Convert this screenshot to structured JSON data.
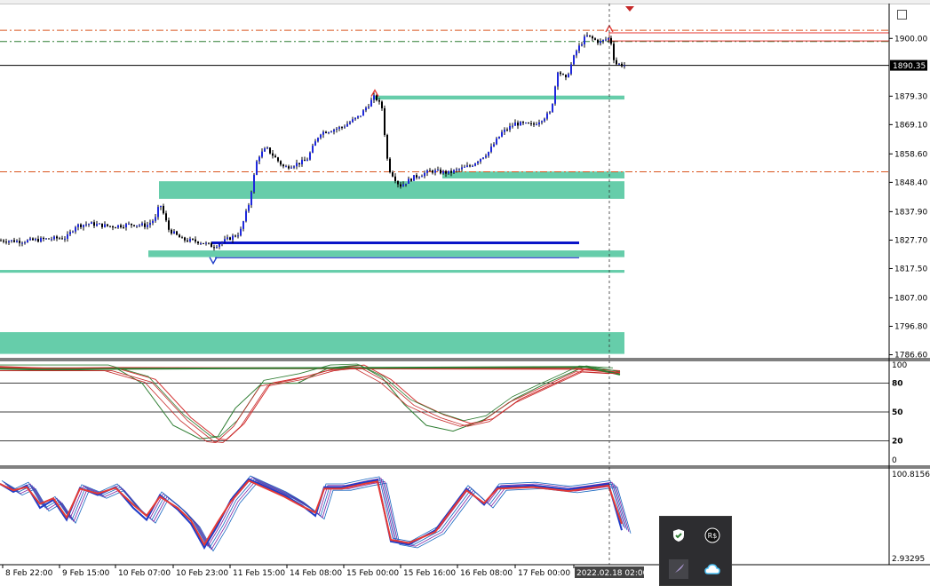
{
  "chart_data": [
    {
      "type": "candlestick",
      "panel": "price",
      "title": "",
      "price_labels": [
        "1900.00",
        "1879.30",
        "1869.10",
        "1858.60",
        "1848.40",
        "1837.90",
        "1827.70",
        "1817.50",
        "1807.00",
        "1796.80",
        "1786.60"
      ],
      "price_label_values": [
        1900.0,
        1879.3,
        1869.1,
        1858.6,
        1848.4,
        1837.9,
        1827.7,
        1817.5,
        1807.0,
        1796.8,
        1786.6
      ],
      "ylim": [
        1785.5,
        1912.5
      ],
      "current_price": "1890.35",
      "current_price_value": 1890.35,
      "trend_waypoints": [
        [
          0,
          1827.6
        ],
        [
          25,
          1827.3
        ],
        [
          50,
          1828.0
        ],
        [
          75,
          1828.6
        ],
        [
          85,
          1832.8
        ],
        [
          100,
          1833.6
        ],
        [
          125,
          1832.6
        ],
        [
          150,
          1833.4
        ],
        [
          165,
          1832.9
        ],
        [
          175,
          1835.5
        ],
        [
          180,
          1841.0
        ],
        [
          190,
          1831.5
        ],
        [
          205,
          1827.9
        ],
        [
          225,
          1827.1
        ],
        [
          240,
          1825.4
        ],
        [
          255,
          1827.8
        ],
        [
          270,
          1830.2
        ],
        [
          280,
          1840.5
        ],
        [
          290,
          1857.5
        ],
        [
          300,
          1860.6
        ],
        [
          320,
          1853.7
        ],
        [
          345,
          1856.2
        ],
        [
          360,
          1866.1
        ],
        [
          385,
          1868.2
        ],
        [
          405,
          1872.2
        ],
        [
          422,
          1879.3
        ],
        [
          430,
          1875.1
        ],
        [
          437,
          1853.7
        ],
        [
          450,
          1847.1
        ],
        [
          465,
          1850.1
        ],
        [
          485,
          1852.5
        ],
        [
          505,
          1851.8
        ],
        [
          530,
          1854.4
        ],
        [
          550,
          1859.3
        ],
        [
          565,
          1866.2
        ],
        [
          580,
          1869.5
        ],
        [
          600,
          1868.9
        ],
        [
          620,
          1873.4
        ],
        [
          628,
          1888.6
        ],
        [
          637,
          1885.3
        ],
        [
          648,
          1895.0
        ],
        [
          660,
          1901.0
        ],
        [
          675,
          1898.6
        ],
        [
          687,
          1900.3
        ],
        [
          692,
          1891.0
        ],
        [
          705,
          1890.3
        ]
      ],
      "levels": [
        {
          "kind": "dash-dot",
          "color": "#d9541e",
          "value": 1902.9
        },
        {
          "kind": "dash-dot",
          "color": "#2e7d32",
          "value": 1898.9
        },
        {
          "kind": "dash-dot",
          "color": "#d9541e",
          "value": 1852.2
        },
        {
          "kind": "solid",
          "color": "#000000",
          "value": 1890.35
        }
      ],
      "zones": [
        {
          "color": "#66cdaa",
          "from": 1878.1,
          "to": 1879.5
        },
        {
          "color": "#66cdaa",
          "from": 1849.8,
          "to": 1852.3
        },
        {
          "color": "#66cdaa",
          "from": 1842.5,
          "to": 1848.8
        },
        {
          "color": "#66cdaa",
          "from": 1821.6,
          "to": 1824.0
        },
        {
          "color": "#66cdaa",
          "from": 1816.0,
          "to": 1817.0
        },
        {
          "color": "#66cdaa",
          "from": 1786.9,
          "to": 1794.7
        }
      ],
      "blue_lines": [
        {
          "value": 1826.7,
          "width": 3
        },
        {
          "value": 1821.4,
          "width": 1
        }
      ],
      "red_box": {
        "from": 1899.1,
        "to": 1902.0
      },
      "arrow_markers": [
        {
          "kind": "up-red",
          "x": 422,
          "value": 1880.5
        },
        {
          "kind": "down-blue",
          "x": 240,
          "value": 1820.3
        },
        {
          "kind": "up-red",
          "x": 686,
          "value": 1903.6
        }
      ]
    },
    {
      "type": "line",
      "panel": "stochastic",
      "title": "",
      "ylim": [
        0,
        100
      ],
      "tick_labels": [
        "100",
        "80",
        "50",
        "20",
        "0"
      ],
      "tick_values": [
        100,
        80,
        50,
        20,
        0
      ],
      "levels": [
        80,
        50,
        20
      ],
      "series": [
        {
          "color": "#d32f2f",
          "width": 1,
          "values": [
            [
              0,
              96
            ],
            [
              130,
              96
            ],
            [
              175,
              84
            ],
            [
              215,
              44
            ],
            [
              245,
              22
            ],
            [
              255,
              21
            ],
            [
              275,
              38
            ],
            [
              305,
              80
            ],
            [
              345,
              87
            ],
            [
              380,
              96
            ],
            [
              410,
              99
            ],
            [
              440,
              84
            ],
            [
              470,
              60
            ],
            [
              500,
              47
            ],
            [
              530,
              38
            ],
            [
              555,
              43
            ],
            [
              585,
              63
            ],
            [
              620,
              78
            ],
            [
              660,
              95
            ],
            [
              698,
              93
            ]
          ]
        },
        {
          "color": "#2e7d32",
          "width": 1,
          "values": [
            [
              0,
              96
            ],
            [
              130,
              96
            ],
            [
              160,
              80
            ],
            [
              195,
              36
            ],
            [
              225,
              22
            ],
            [
              245,
              24
            ],
            [
              265,
              54
            ],
            [
              295,
              80
            ],
            [
              335,
              80
            ],
            [
              370,
              96
            ],
            [
              405,
              99
            ],
            [
              430,
              86
            ],
            [
              455,
              58
            ],
            [
              480,
              36
            ],
            [
              510,
              30
            ],
            [
              545,
              42
            ],
            [
              580,
              64
            ],
            [
              615,
              80
            ],
            [
              660,
              98
            ],
            [
              698,
              92
            ]
          ]
        },
        {
          "color": "#d32f2f",
          "width": 2,
          "values": [
            [
              0,
              97
            ],
            [
              60,
              95
            ],
            [
              130,
              96
            ],
            [
              650,
              95
            ],
            [
              698,
              91
            ]
          ]
        },
        {
          "color": "#2e7d32",
          "width": 2,
          "values": [
            [
              0,
              95
            ],
            [
              60,
              94
            ],
            [
              130,
              95
            ],
            [
              660,
              97
            ],
            [
              698,
              89
            ]
          ]
        }
      ]
    },
    {
      "type": "line",
      "panel": "oscillator",
      "title": "",
      "tick_labels": [
        "100.81563",
        "2.93295"
      ],
      "tick_values": [
        100.81563,
        2.93295
      ],
      "ylim": [
        0,
        104
      ],
      "series": [
        {
          "color": "#1e3cc8",
          "width": 2,
          "values": [
            [
              0,
              90
            ],
            [
              15,
              80
            ],
            [
              30,
              88
            ],
            [
              45,
              60
            ],
            [
              60,
              70
            ],
            [
              75,
              45
            ],
            [
              90,
              85
            ],
            [
              110,
              76
            ],
            [
              130,
              86
            ],
            [
              150,
              60
            ],
            [
              165,
              45
            ],
            [
              180,
              76
            ],
            [
              200,
              58
            ],
            [
              215,
              40
            ],
            [
              230,
              10
            ],
            [
              245,
              38
            ],
            [
              260,
              70
            ],
            [
              280,
              96
            ],
            [
              300,
              86
            ],
            [
              320,
              76
            ],
            [
              340,
              63
            ],
            [
              355,
              50
            ],
            [
              365,
              86
            ],
            [
              385,
              86
            ],
            [
              410,
              92
            ],
            [
              425,
              95
            ],
            [
              440,
              18
            ],
            [
              460,
              14
            ],
            [
              490,
              32
            ],
            [
              525,
              84
            ],
            [
              545,
              64
            ],
            [
              560,
              86
            ],
            [
              600,
              88
            ],
            [
              640,
              83
            ],
            [
              660,
              86
            ],
            [
              685,
              90
            ],
            [
              700,
              32
            ]
          ]
        },
        {
          "color": "#e53935",
          "width": 2,
          "values": [
            [
              0,
              90
            ],
            [
              15,
              82
            ],
            [
              30,
              86
            ],
            [
              45,
              65
            ],
            [
              60,
              72
            ],
            [
              75,
              48
            ],
            [
              90,
              84
            ],
            [
              110,
              78
            ],
            [
              130,
              85
            ],
            [
              150,
              64
            ],
            [
              165,
              50
            ],
            [
              180,
              74
            ],
            [
              200,
              60
            ],
            [
              215,
              44
            ],
            [
              230,
              14
            ],
            [
              245,
              42
            ],
            [
              260,
              68
            ],
            [
              280,
              94
            ],
            [
              300,
              84
            ],
            [
              320,
              74
            ],
            [
              340,
              62
            ],
            [
              355,
              54
            ],
            [
              365,
              84
            ],
            [
              385,
              84
            ],
            [
              410,
              90
            ],
            [
              425,
              93
            ],
            [
              440,
              20
            ],
            [
              460,
              16
            ],
            [
              490,
              30
            ],
            [
              525,
              82
            ],
            [
              545,
              66
            ],
            [
              560,
              84
            ],
            [
              600,
              86
            ],
            [
              640,
              81
            ],
            [
              660,
              84
            ],
            [
              685,
              88
            ],
            [
              700,
              40
            ]
          ]
        }
      ]
    }
  ],
  "x_axis": {
    "labels": [
      "8 Feb 22:00",
      "9 Feb 15:00",
      "10 Feb 07:00",
      "10 Feb 23:00",
      "11 Feb 15:00",
      "14 Feb 08:00",
      "15 Feb 00:00",
      "15 Feb 16:00",
      "16 Feb 08:00",
      "17 Feb 00:00",
      "2022.02.18 02:00"
    ]
  },
  "tray": {
    "icons": [
      "shield-check-icon",
      "app-rs-icon",
      "feather-pen-icon",
      "onedrive-cloud-icon"
    ],
    "rs_label": "R$"
  },
  "colors": {
    "zone": "#66cdaa",
    "blue_line": "#0a14c8",
    "bull_candle": "#1e28dc",
    "bear_candle": "#000000",
    "grid": "#000000"
  }
}
